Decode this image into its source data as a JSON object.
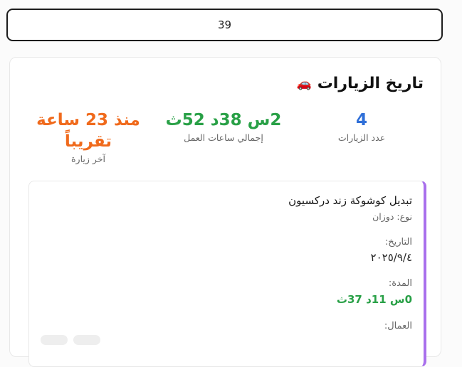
{
  "search": {
    "value": "39"
  },
  "history": {
    "title": "تاريخ الزيارات",
    "icon": "car-icon",
    "stats": {
      "visits_count": {
        "value": "4",
        "label": "عدد الزيارات"
      },
      "total_hours": {
        "value": "2س 38د 52ث",
        "label": "إجمالي ساعات العمل"
      },
      "last_visit": {
        "value": "منذ 23 ساعة تقريباً",
        "label": "آخر زيارة"
      }
    },
    "visit": {
      "title": "تبديل كوشوكة زند دركسيون",
      "type": "نوع: دوزان",
      "date_label": "التاريخ:",
      "date_value": "٢٠٢٥/٩/٤",
      "duration_label": "المدة:",
      "duration_value": "0س 11د 37ث",
      "workers_label": "العمال:"
    }
  }
}
